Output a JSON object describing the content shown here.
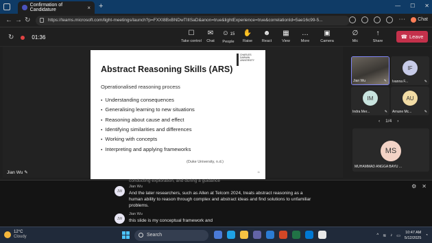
{
  "browser": {
    "tab_title": "Confirmation of Candidature",
    "url": "https://teams.microsoft.com/light-meetings/launch?p=FXXI8BxBNDwTIlISaD&anon=true&lightExperience=true&correlationId=5ae16c99-5...",
    "chat_label": "Chat"
  },
  "meeting": {
    "timer": "01:36",
    "controls": [
      {
        "label": "Take control",
        "icon": "take-control-icon",
        "glyph": "☐"
      },
      {
        "label": "Chat",
        "icon": "chat-icon",
        "glyph": "✉"
      },
      {
        "label": "People",
        "icon": "people-icon",
        "glyph": "☺",
        "badge": "15"
      },
      {
        "label": "Raise",
        "icon": "raise-hand-icon",
        "glyph": "✋"
      },
      {
        "label": "React",
        "icon": "react-icon",
        "glyph": "☻"
      },
      {
        "label": "View",
        "icon": "view-icon",
        "glyph": "▦"
      },
      {
        "label": "More",
        "icon": "more-icon",
        "glyph": "…"
      },
      {
        "label": "Camera",
        "icon": "camera-icon",
        "glyph": "▣"
      },
      {
        "label": "Mic",
        "icon": "mic-off-icon",
        "glyph": "∅"
      },
      {
        "label": "Share",
        "icon": "share-icon",
        "glyph": "↑"
      }
    ],
    "leave_label": "Leave"
  },
  "slide": {
    "title": "Abstract Reasoning Skills (ARS)",
    "logo_text": "CHARLES DARWIN UNIVERSITY",
    "subtitle": "Operationalised reasoning process",
    "bullets": [
      "Understanding consequences",
      "Generalising learning to new situations",
      "Reasoning about cause and effect",
      "Identifying similarities and differences",
      "Working with concepts",
      "Interpreting and applying frameworks"
    ],
    "citation": "(Duke University, n.d.)",
    "page": "11"
  },
  "presenter": {
    "name": "Jian Wu"
  },
  "participants": [
    {
      "initials": "",
      "name": "Jian Wu",
      "color": "#4a4a4a",
      "active": true,
      "video": true
    },
    {
      "initials": "IF",
      "name": "Ivanna F...",
      "color": "#c7cbe8"
    },
    {
      "initials": "IM",
      "name": "Indra Mer...",
      "color": "#c9e4df"
    },
    {
      "initials": "AU",
      "name": "Arnune Mc...",
      "color": "#f2dca5"
    }
  ],
  "pager": {
    "text": "1/4"
  },
  "big_participant": {
    "initials": "MS",
    "name": "MUHAMMAD ANGGA BAYU ..."
  },
  "captions": {
    "previous_line": "conducting exploration, and during a guidance",
    "entries": [
      {
        "initials": "JW",
        "speaker": "Jian Wu",
        "text": "And the later researchers, such as Allen at Telcom 2024, treats abstract reasoning as a human ability to reason through complex and abstract ideas and find solutions to unfamiliar problems."
      },
      {
        "initials": "JW",
        "speaker": "Jian Wu",
        "text": "this slide is my conceptual framework and"
      }
    ]
  },
  "taskbar": {
    "weather_temp": "12°C",
    "weather_desc": "Cloudy",
    "search_placeholder": "Search",
    "time": "10:47 AM",
    "date": "5/12/2025"
  }
}
